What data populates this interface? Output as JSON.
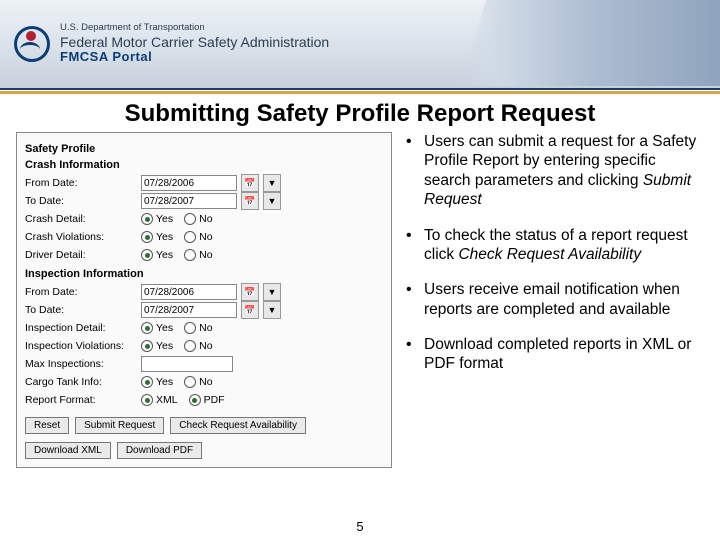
{
  "header": {
    "dept": "U.S. Department of Transportation",
    "agency": "Federal Motor Carrier Safety Administration",
    "portal": "FMCSA Portal"
  },
  "title": "Submitting Safety Profile Report Request",
  "form": {
    "section_profile": "Safety Profile",
    "section_crash": "Crash Information",
    "section_inspection": "Inspection Information",
    "from_label": "From Date:",
    "to_label": "To Date:",
    "crash_from": "07/28/2006",
    "crash_to": "07/28/2007",
    "insp_from": "07/28/2006",
    "insp_to": "07/28/2007",
    "crash_detail_label": "Crash Detail:",
    "crash_viol_label": "Crash Violations:",
    "driver_detail_label": "Driver Detail:",
    "insp_detail_label": "Inspection Detail:",
    "insp_viol_label": "Inspection Violations:",
    "max_insp_label": "Max Inspections:",
    "cargo_tank_label": "Cargo Tank Info:",
    "report_fmt_label": "Report Format:",
    "yes": "Yes",
    "no": "No",
    "xml": "XML",
    "pdf": "PDF",
    "buttons": {
      "reset": "Reset",
      "submit": "Submit Request",
      "check": "Check Request Availability",
      "dl_xml": "Download XML",
      "dl_pdf": "Download PDF"
    }
  },
  "bullets": {
    "b1a": "Users can submit a request for a Safety Profile Report by entering specific search parameters and clicking ",
    "b1b": "Submit Request",
    "b2a": "To check the status of a report request click ",
    "b2b": "Check Request Availability",
    "b3": "Users receive email notification when reports are completed and available",
    "b4": "Download completed reports in XML or PDF format"
  },
  "page_number": "5"
}
